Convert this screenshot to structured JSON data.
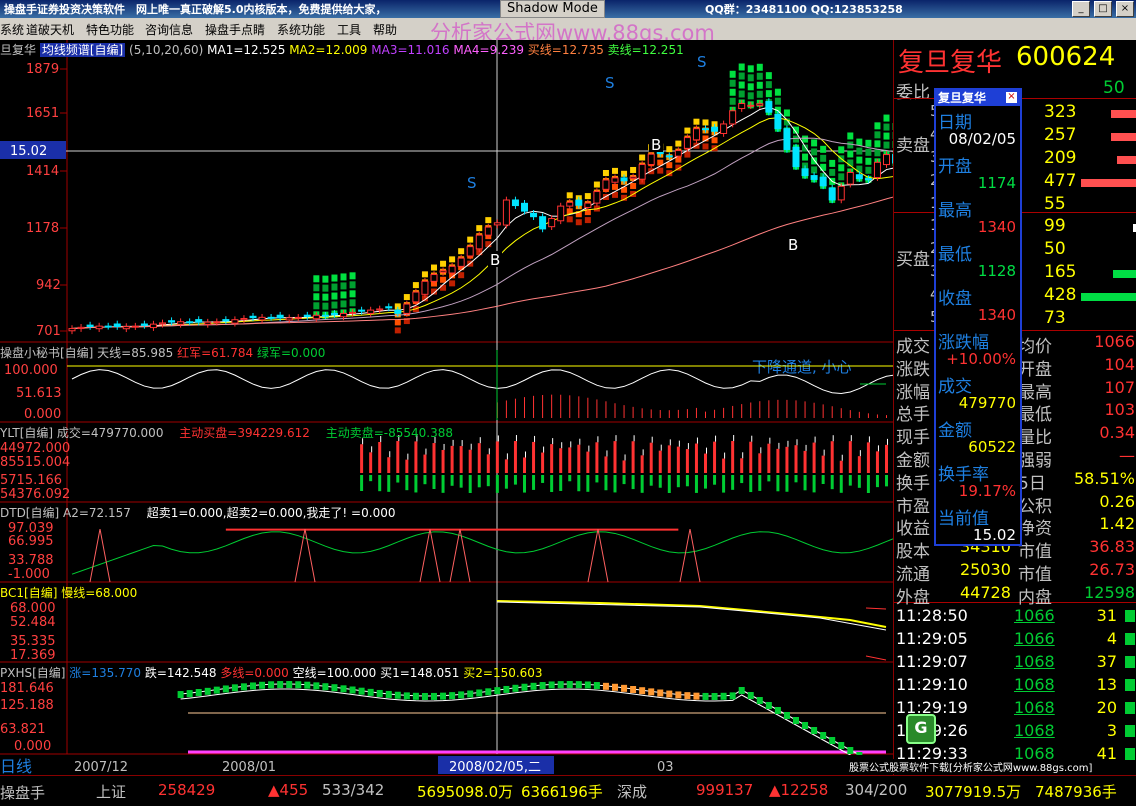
{
  "titlebar": {
    "title": "操盘手证券投资决策软件　网上唯一真正破解5.0内核版本，免费提供给大家，",
    "shadow_mode": "Shadow Mode",
    "contact": "QQ群：23481100 QQ:123853258",
    "watermark": "分析家公式网www.88gs.com"
  },
  "menu": [
    "系统",
    "道破天机",
    "特色功能",
    "咨询信息",
    "操盘手点睛",
    "系统功能",
    "工具",
    "帮助"
  ],
  "chart": {
    "stock_name": "复旦复华",
    "main_header": {
      "name": "旦复华",
      "indicator": "均线频谱[自编]",
      "params": "(5,10,20,60)",
      "ma1": "MA1=12.525",
      "ma2": "MA2=12.009",
      "ma3": "MA3=11.016",
      "ma4": "MA4=9.239",
      "buy": "买线=12.735",
      "sell": "卖线=12.251"
    },
    "y_labels": [
      "1879",
      "1651",
      "1414",
      "1178",
      "942",
      "701"
    ],
    "cursor_price": "15.02",
    "signals": {
      "S": "S",
      "B": "B"
    },
    "p2": {
      "header": "操盘小秘书[自编] 天线=85.985",
      "red": "红军=61.784",
      "green": "绿军=0.000",
      "y": [
        "100.000",
        "51.613",
        "0.000"
      ],
      "note": "下降通道, 小心"
    },
    "p3": {
      "header": "YLT[自编] 成交=479770.000",
      "buy": "主动买盘=394229.612",
      "sell": "主动卖盘=-85540.388",
      "y": [
        "44972.000",
        "85515.004",
        "5715.166",
        "54376.092"
      ]
    },
    "p4": {
      "header": "DTD[自编] A2=72.157",
      "a": "超卖1=0.000,超卖2=0.000,我走了! =0.000",
      "y": [
        "97.039",
        "66.995",
        "33.788",
        "-1.000"
      ]
    },
    "p5": {
      "header": "BC1[自编] 慢线=68.000",
      "y": [
        "68.000",
        "52.484",
        "35.335",
        "17.369"
      ]
    },
    "p6": {
      "header": "PXHS[自编]",
      "a": "涨=135.770",
      "b": "跌=142.548",
      "c": "多线=0.000",
      "d": "空线=100.000",
      "e": "买1=148.051",
      "f": "买2=150.603",
      "y": [
        "181.646",
        "125.188",
        "63.821",
        "0.000"
      ]
    },
    "x_labels": [
      "2007/12",
      "2008/01",
      "2008/02/05,二",
      "03"
    ],
    "period_label": "日线"
  },
  "right_panel": {
    "name": "复旦复华",
    "code": "600624",
    "weibi_label": "委比",
    "weibi_value": "50",
    "sell_label": "卖盘",
    "buy_label": "买盘",
    "sell_levels": [
      {
        "n": "5",
        "v": "323"
      },
      {
        "n": "4",
        "v": "257"
      },
      {
        "n": "3",
        "v": "209"
      },
      {
        "n": "2",
        "v": "477"
      },
      {
        "n": "1",
        "v": "55"
      }
    ],
    "buy_levels": [
      {
        "n": "1",
        "v": "99"
      },
      {
        "n": "2",
        "v": "50"
      },
      {
        "n": "3",
        "v": "165"
      },
      {
        "n": "4",
        "v": "428"
      },
      {
        "n": "5",
        "v": "73"
      }
    ],
    "stats_left": [
      {
        "label": "成交",
        "value": ""
      },
      {
        "label": "涨跌",
        "value": ""
      },
      {
        "label": "涨幅",
        "value": ""
      },
      {
        "label": "总手",
        "value": ""
      },
      {
        "label": "现手",
        "value": ""
      },
      {
        "label": "金额",
        "value": ""
      },
      {
        "label": "换手",
        "value": ""
      },
      {
        "label": "市盈",
        "value": ""
      },
      {
        "label": "收益",
        "value": ""
      },
      {
        "label": "股本",
        "value": "34310"
      },
      {
        "label": "流通",
        "value": "25030"
      },
      {
        "label": "外盘",
        "value": "44728"
      }
    ],
    "stats_right": [
      {
        "label": "均价",
        "value": "1066"
      },
      {
        "label": "开盘",
        "value": "104"
      },
      {
        "label": "最高",
        "value": "107"
      },
      {
        "label": "最低",
        "value": "103"
      },
      {
        "label": "量比",
        "value": "0.34"
      },
      {
        "label": "强弱",
        "value": "—"
      },
      {
        "label": "5日",
        "value": "58.51%"
      },
      {
        "label": "公积",
        "value": "0.26"
      },
      {
        "label": "净资",
        "value": "1.42"
      },
      {
        "label": "市值",
        "value": "36.83"
      },
      {
        "label": "市值",
        "value": "26.73"
      },
      {
        "label": "内盘",
        "value": "12598"
      }
    ],
    "ticks": [
      {
        "t": "11:28:50",
        "p": "1066",
        "v": "31"
      },
      {
        "t": "11:29:05",
        "p": "1066",
        "v": "4"
      },
      {
        "t": "11:29:07",
        "p": "1068",
        "v": "37"
      },
      {
        "t": "11:29:10",
        "p": "1068",
        "v": "13"
      },
      {
        "t": "11:29:19",
        "p": "1068",
        "v": "20"
      },
      {
        "t": "11:29:26",
        "p": "1068",
        "v": "3"
      },
      {
        "t": "11:29:33",
        "p": "1068",
        "v": "41"
      }
    ],
    "ad": "股票公式股票软件下载[分析家公式网www.88gs.com]"
  },
  "popup": {
    "title": "复旦复华",
    "close": "×",
    "items": [
      {
        "label": "日期",
        "value": "08/02/05"
      },
      {
        "label": "开盘",
        "value": "1174"
      },
      {
        "label": "最高",
        "value": "1340"
      },
      {
        "label": "最低",
        "value": "1128"
      },
      {
        "label": "收盘",
        "value": "1340"
      },
      {
        "label": "涨跌幅",
        "value": "+10.00%"
      },
      {
        "label": "成交",
        "value": "479770"
      },
      {
        "label": "金额",
        "value": "60522"
      },
      {
        "label": "换手率",
        "value": "19.17%"
      },
      {
        "label": "当前值",
        "value": "15.02"
      }
    ]
  },
  "bottombar": {
    "a": "操盘手",
    "b": "上证",
    "c": "258429",
    "d": "▲455",
    "e": "533/342",
    "f": "5695098.0万",
    "g": "6366196手",
    "h": "深成",
    "i": "999137",
    "j": "▲12258",
    "k": "304/200",
    "l": "3077919.5万",
    "m": "7487936手"
  },
  "colors": {
    "up": "#ff3232",
    "down": "#00e5ff",
    "green": "#00cc33",
    "yellow": "#ffff00",
    "blue": "#1e7fe0"
  }
}
